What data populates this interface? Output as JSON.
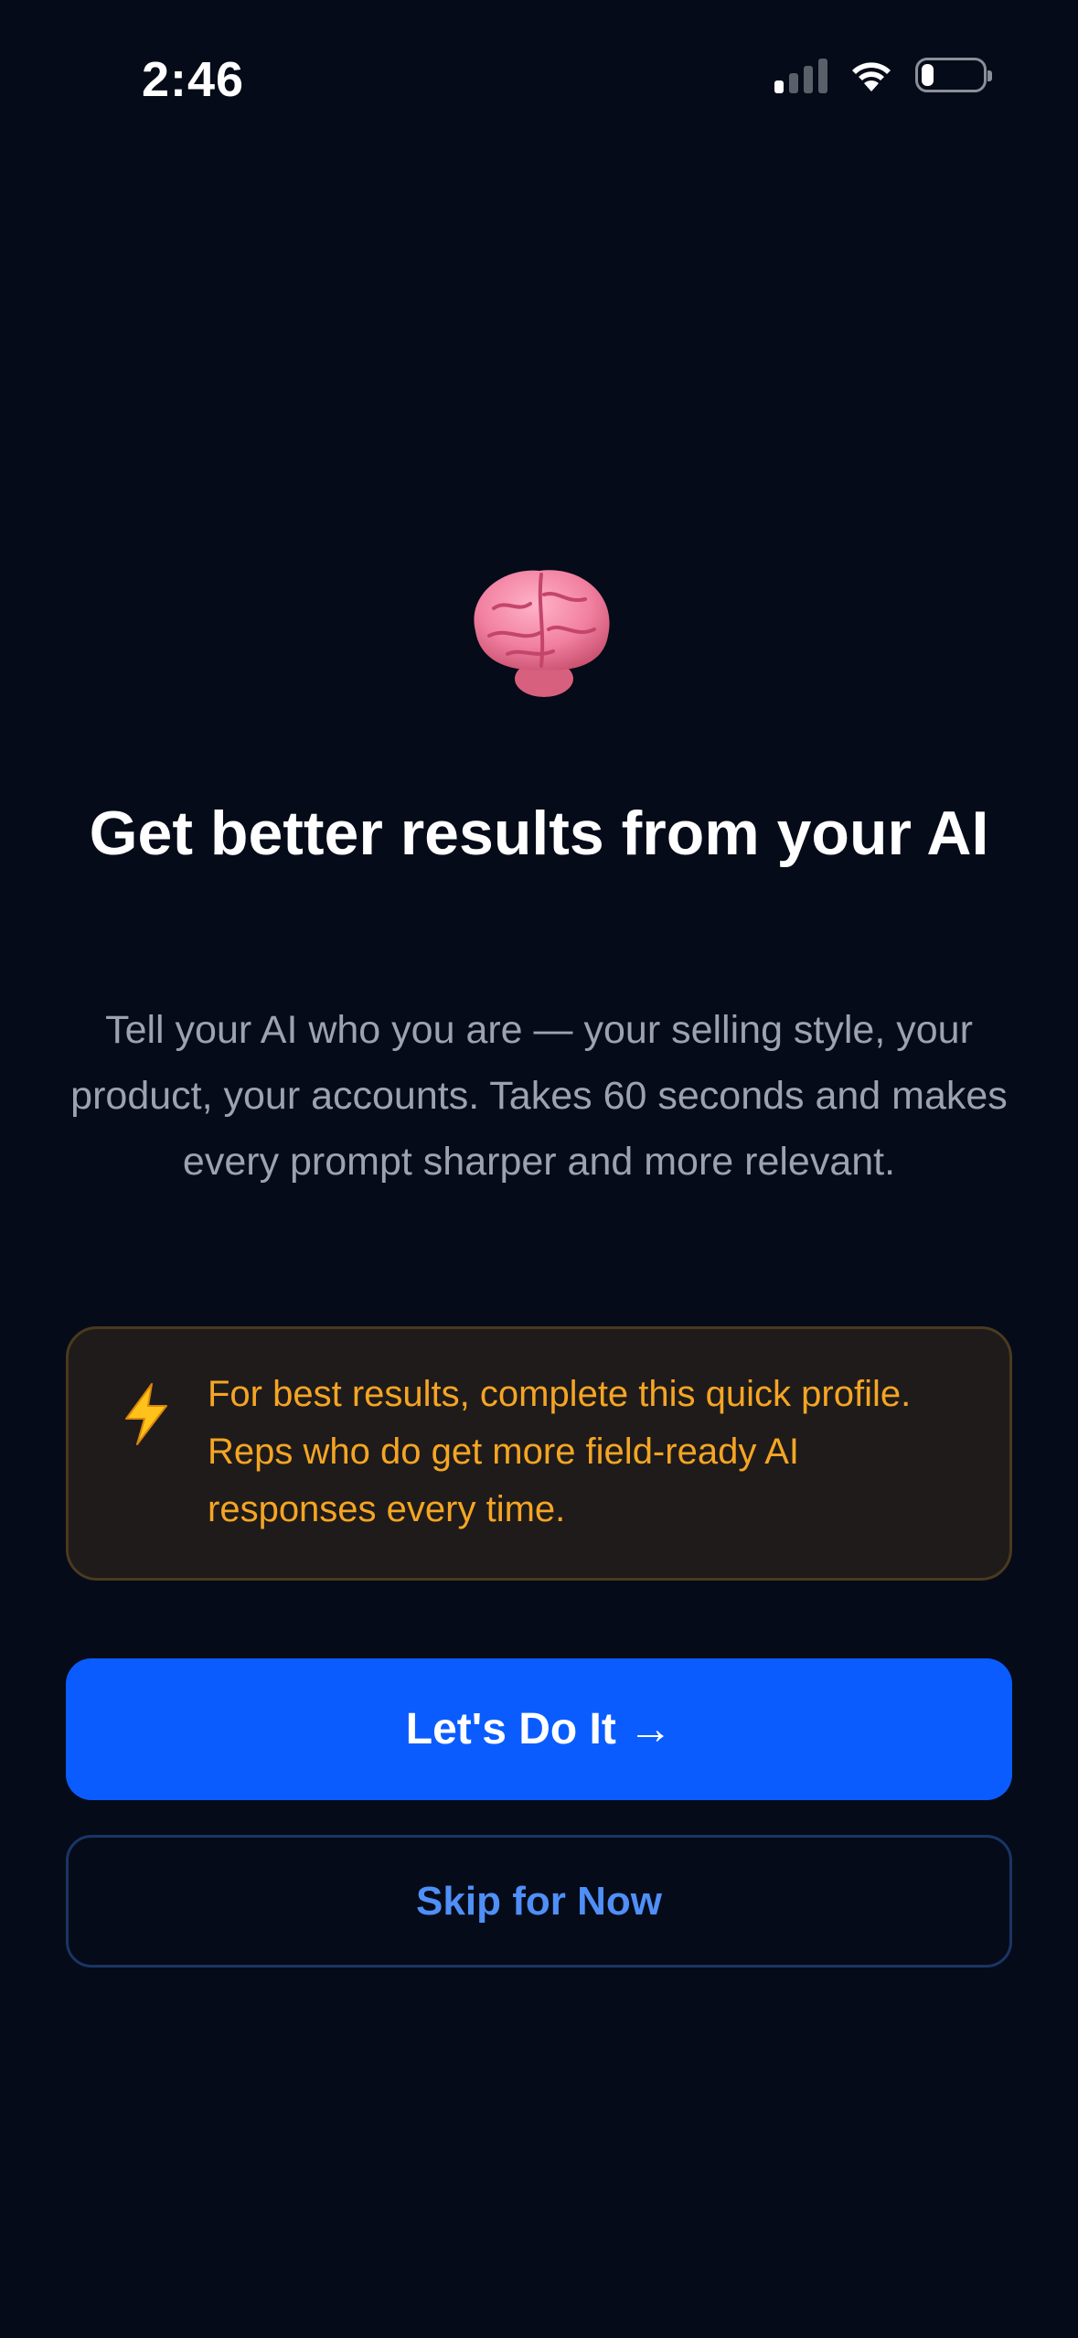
{
  "status_bar": {
    "time": "2:46",
    "signal_bars_active": 1,
    "signal_bars_total": 4,
    "battery_level": 0.2
  },
  "hero": {
    "icon": "brain-emoji",
    "title": "Get better results from your AI",
    "subtitle": "Tell your AI who you are — your selling style, your product, your accounts. Takes 60 seconds and makes every prompt sharper and more relevant."
  },
  "callout": {
    "icon": "lightning-icon",
    "text": "For best results, complete this quick profile. Reps who do get more field-ready AI responses every time."
  },
  "actions": {
    "primary_label": "Let's Do It →",
    "secondary_label": "Skip for Now"
  },
  "colors": {
    "background": "#050b18",
    "primary": "#0a5cff",
    "secondary_text": "#4f8ff7",
    "callout_text": "#f5a524",
    "callout_bg": "#1f1b1a",
    "subtitle_text": "#9ca3af"
  }
}
